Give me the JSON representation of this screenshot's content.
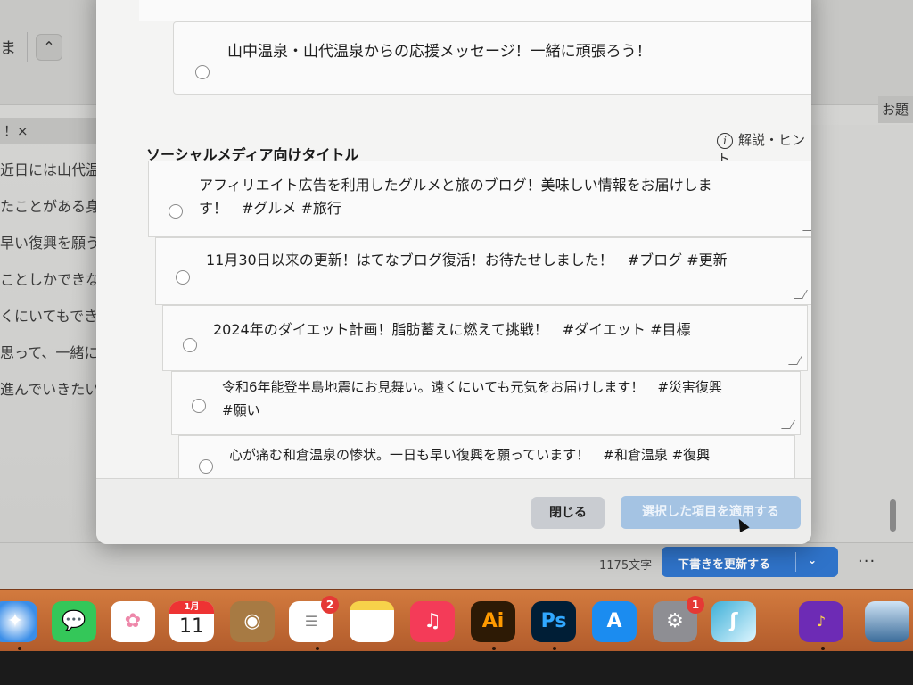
{
  "background_editor": {
    "left_chars": "ま",
    "tag_text": "！×",
    "text_lines": [
      "近日には山代温泉に",
      "たことがある身",
      "早い復興を願うに",
      "ことしかできない",
      "くにいてもできるこ",
      "思って、一緒に",
      "進んでいきたいと思っ"
    ],
    "right_tag": "お題"
  },
  "modal": {
    "previous_item_text": "山中温泉・山代温泉からの応援メッセージ！一緒に頑張ろう！",
    "section_title": "ソーシャルメディア向けタイトル",
    "hint_label": "解説・ヒント",
    "options": [
      {
        "line1": "アフィリエイト広告を利用したグルメと旅のブログ！美味しい情報をお届けしま",
        "line2": "す！　#グルメ #旅行"
      },
      {
        "line1": "11月30日以来の更新！はてなブログ復活！お待たせしました！　#ブログ #更新",
        "line2": ""
      },
      {
        "line1": "2024年のダイエット計画！脂肪蓄えに燃えて挑戦！　#ダイエット #目標",
        "line2": ""
      },
      {
        "line1": "令和6年能登半島地震にお見舞い。遠くにいても元気をお届けします！　#災害復興",
        "line2": "#願い"
      },
      {
        "line1": "心が痛む和倉温泉の惨状。一日も早い復興を願っています！　#和倉温泉 #復興",
        "line2": ""
      }
    ],
    "close_label": "閉じる",
    "apply_label": "選択した項目を適用する"
  },
  "statusbar": {
    "char_count": "1175文字",
    "update_label": "下書きを更新する",
    "chevron": "⌄",
    "more": "···"
  },
  "dock": {
    "calendar_month": "1月",
    "calendar_day": "11",
    "reminders_badge": "2",
    "settings_badge": "1",
    "illustrator_label": "Ai",
    "photoshop_label": "Ps",
    "apps": [
      "safari-icon",
      "messages-icon",
      "photos-icon",
      "calendar-icon",
      "contacts-icon",
      "reminders-icon",
      "notes-icon",
      "music-icon",
      "illustrator-icon",
      "photoshop-icon",
      "app-store-icon",
      "system-settings-icon",
      "unknown-app-icon",
      "intro-app-icon",
      "photo-app-icon"
    ]
  }
}
